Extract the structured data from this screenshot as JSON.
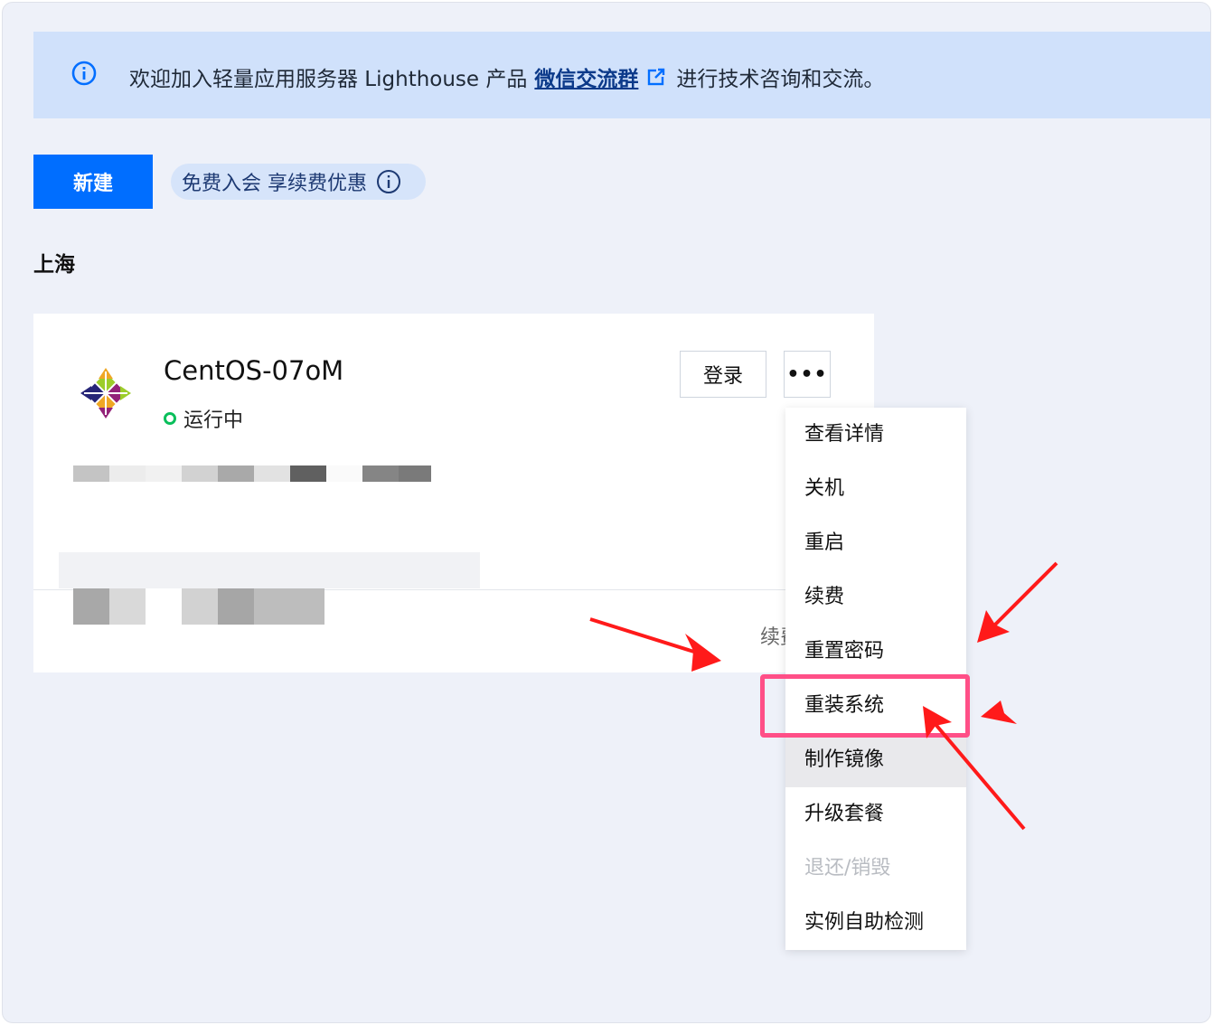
{
  "notice": {
    "text_before": "欢迎加入轻量应用服务器 Lighthouse 产品",
    "link": "微信交流群",
    "text_after": "进行技术咨询和交流。",
    "icon": "info-icon"
  },
  "toolbar": {
    "new_label": "新建",
    "member_label": "免费入会 享续费优惠"
  },
  "region": "上海",
  "instance": {
    "name": "CentOS-07oM",
    "status": "运行中",
    "os_icon": "centos-logo",
    "login_label": "登录",
    "more_label": "•••",
    "renew_fragment": "续费"
  },
  "menu": {
    "items": [
      {
        "label": "查看详情"
      },
      {
        "label": "关机"
      },
      {
        "label": "重启"
      },
      {
        "label": "续费"
      },
      {
        "label": "重置密码"
      },
      {
        "label": "重装系统"
      },
      {
        "label": "制作镜像"
      },
      {
        "label": "升级套餐"
      },
      {
        "label": "退还/销毁"
      },
      {
        "label": "实例自助检测"
      }
    ]
  },
  "colors": {
    "primary": "#006eff",
    "running": "#0abf5b",
    "highlight": "#ff4f87",
    "arrow": "#ff1a1a",
    "notice_bg": "#d0e1fb"
  }
}
